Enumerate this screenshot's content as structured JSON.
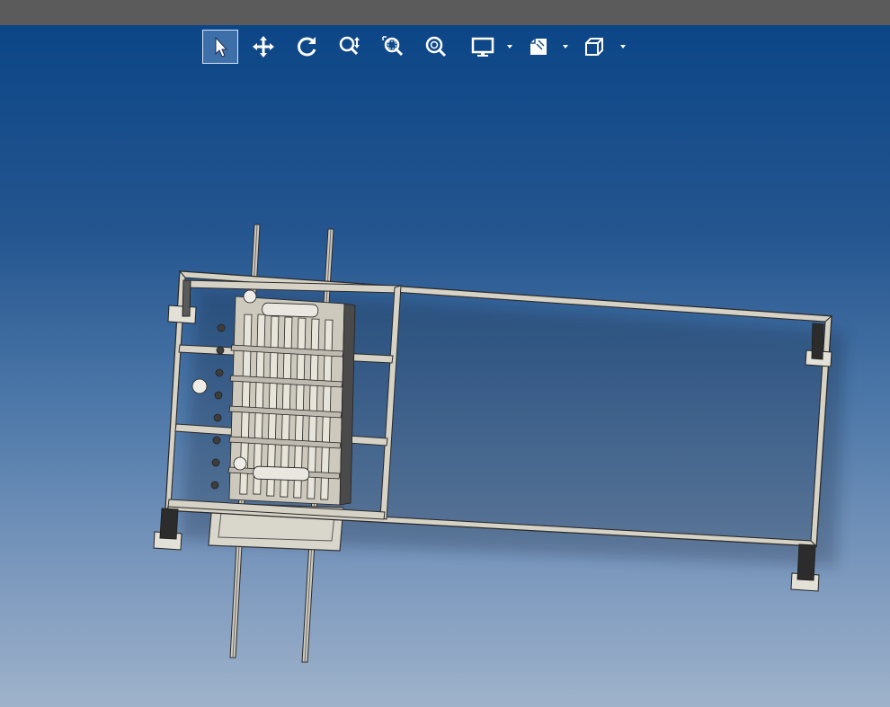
{
  "window": {
    "titlebar_color": "#5b5b5b"
  },
  "viewport": {
    "background_top": "#0c4687",
    "background_bottom": "#9eb2ca",
    "model_name": "frame-assembly-3d-model"
  },
  "toolbar": {
    "tools": [
      {
        "name": "select-tool",
        "icon": "cursor-arrow-icon",
        "active": true
      },
      {
        "name": "pan-tool",
        "icon": "move-arrows-icon",
        "active": false
      },
      {
        "name": "rotate-tool",
        "icon": "rotate-icon",
        "active": false
      },
      {
        "name": "zoom-in-out-tool",
        "icon": "zoom-in-out-icon",
        "active": false
      },
      {
        "name": "zoom-to-area-tool",
        "icon": "zoom-area-icon",
        "active": false
      },
      {
        "name": "zoom-to-fit-tool",
        "icon": "zoom-fit-icon",
        "active": false
      },
      {
        "name": "display-style-dropdown",
        "icon": "monitor-icon",
        "active": false
      },
      {
        "name": "view-settings-dropdown",
        "icon": "view-settings-icon",
        "active": false
      },
      {
        "name": "view-orientation-dropdown",
        "icon": "cube-icon",
        "active": false
      }
    ]
  }
}
